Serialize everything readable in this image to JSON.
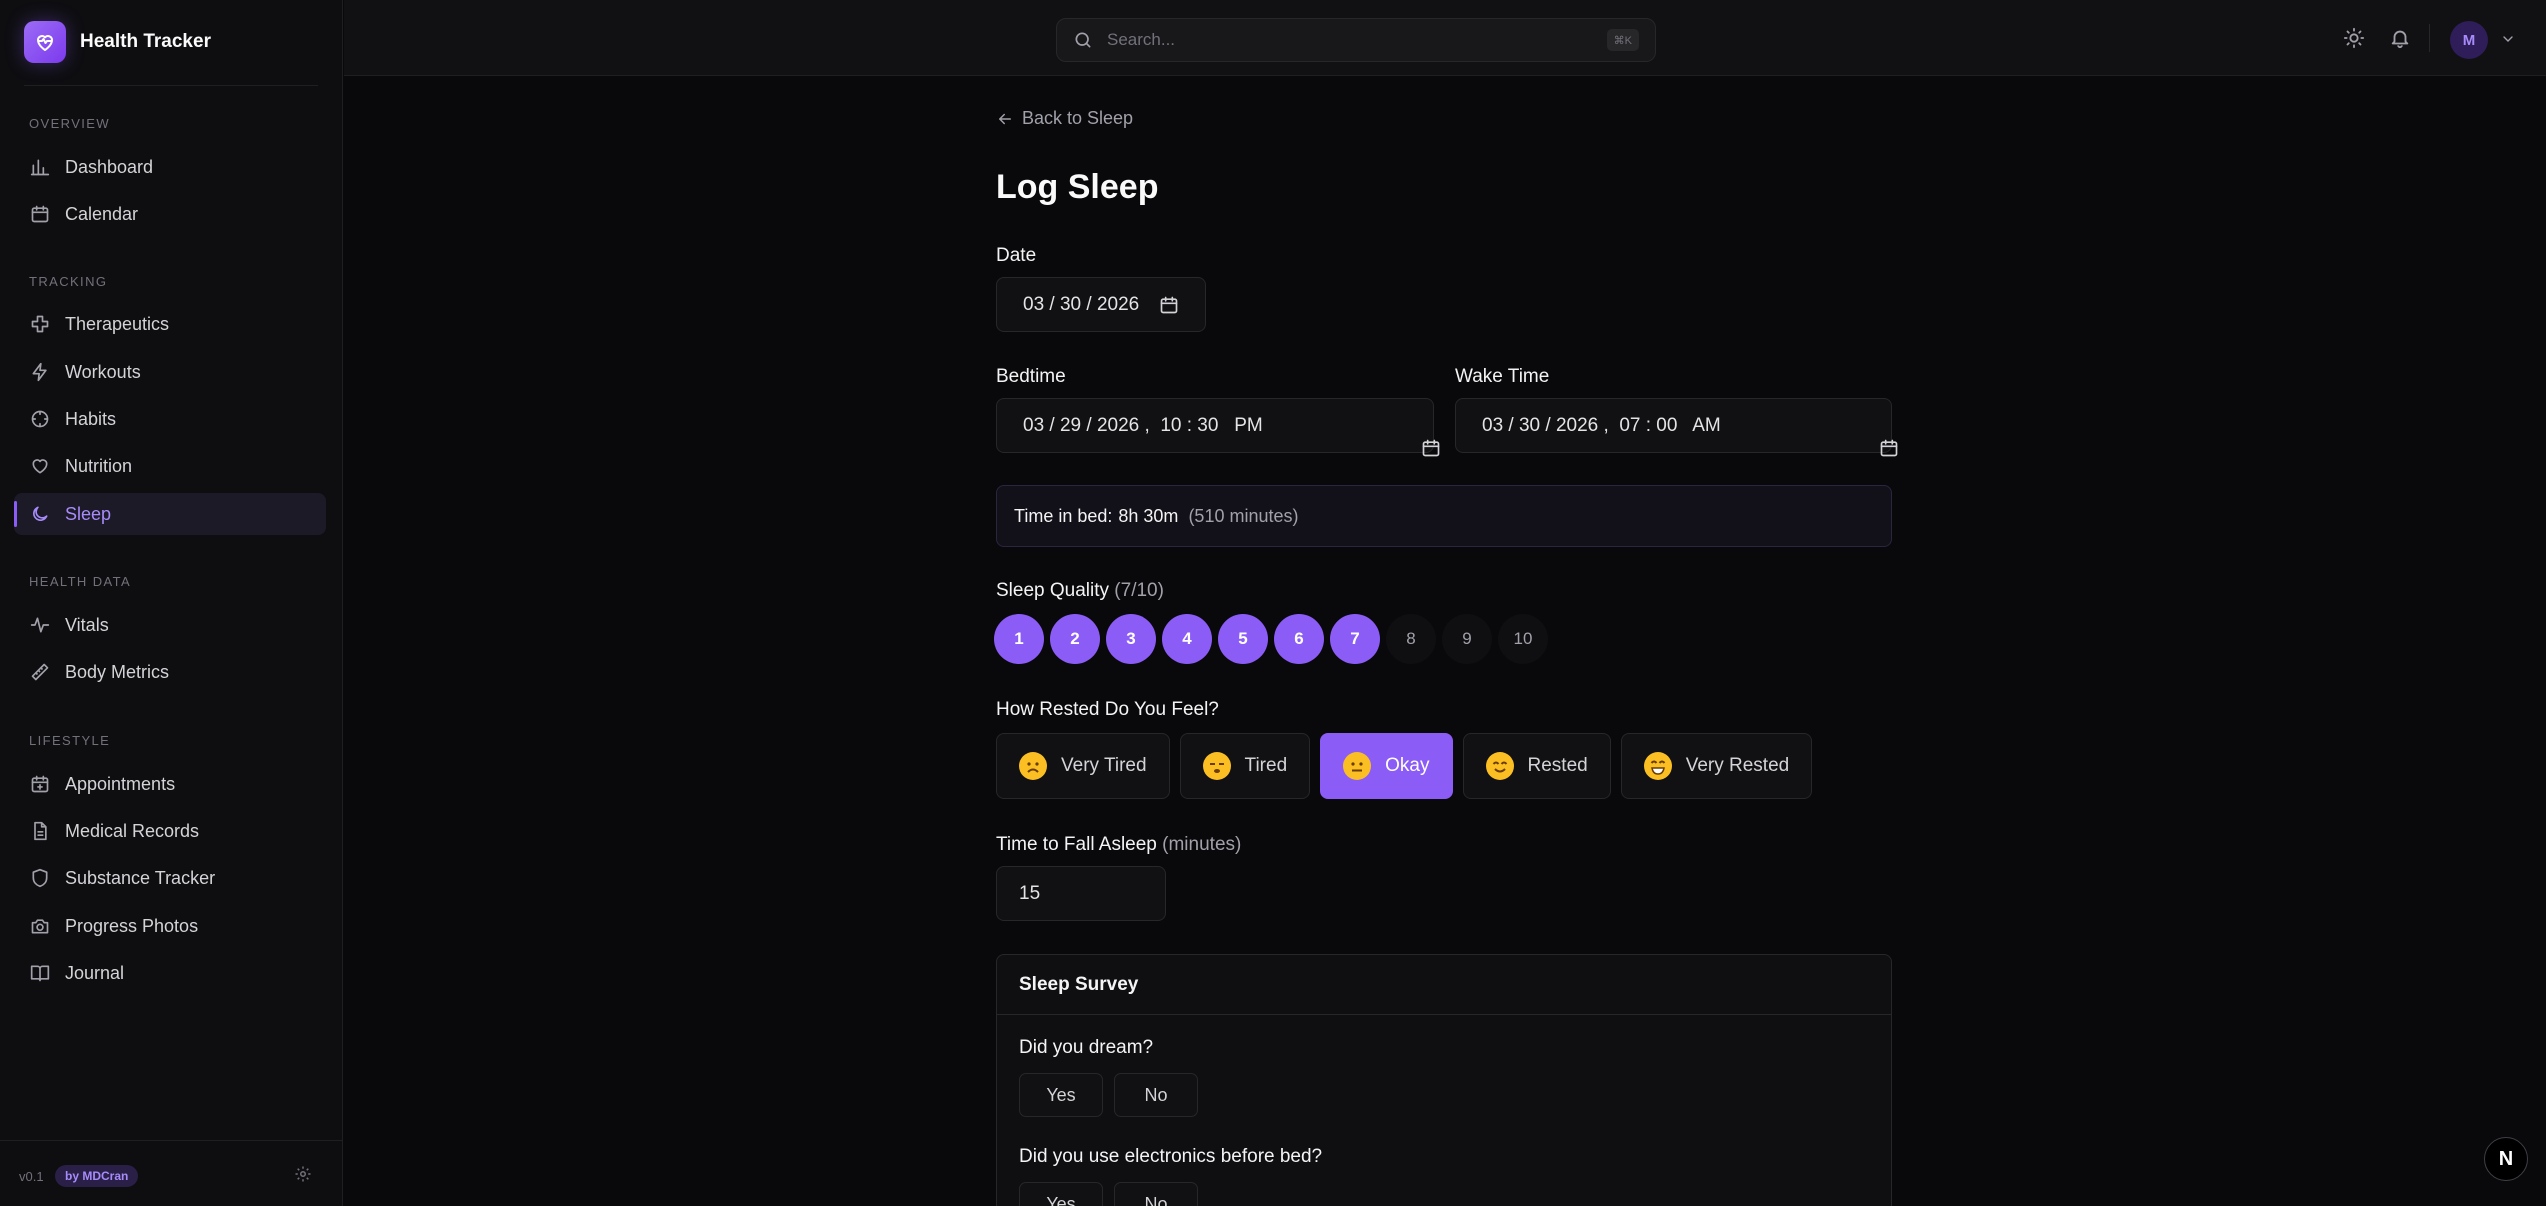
{
  "brand": {
    "name": "Health Tracker"
  },
  "sidebar": {
    "groups": [
      {
        "title": "OVERVIEW",
        "items": [
          {
            "label": "Dashboard",
            "icon": "bar-chart-icon"
          },
          {
            "label": "Calendar",
            "icon": "calendar-icon"
          }
        ]
      },
      {
        "title": "TRACKING",
        "items": [
          {
            "label": "Therapeutics",
            "icon": "cross-icon"
          },
          {
            "label": "Workouts",
            "icon": "lightning-icon"
          },
          {
            "label": "Habits",
            "icon": "target-icon"
          },
          {
            "label": "Nutrition",
            "icon": "heart-icon"
          },
          {
            "label": "Sleep",
            "icon": "moon-icon",
            "active": true
          }
        ]
      },
      {
        "title": "HEALTH DATA",
        "items": [
          {
            "label": "Vitals",
            "icon": "pulse-icon"
          },
          {
            "label": "Body Metrics",
            "icon": "ruler-icon"
          }
        ]
      },
      {
        "title": "LIFESTYLE",
        "items": [
          {
            "label": "Appointments",
            "icon": "calendar-plus-icon"
          },
          {
            "label": "Medical Records",
            "icon": "document-icon"
          },
          {
            "label": "Substance Tracker",
            "icon": "shield-icon"
          },
          {
            "label": "Progress Photos",
            "icon": "camera-icon"
          },
          {
            "label": "Journal",
            "icon": "book-icon"
          }
        ]
      }
    ],
    "footer": {
      "version": "v0.1",
      "badge": "by MDCran"
    }
  },
  "topbar": {
    "search_placeholder": "Search...",
    "search_shortcut": "⌘K",
    "avatar_initial": "M"
  },
  "page": {
    "back_link": "Back to Sleep",
    "title": "Log Sleep",
    "date": {
      "label": "Date",
      "value": "03 / 30 / 2026"
    },
    "bedtime": {
      "label": "Bedtime",
      "value": "03 / 29 / 2026 ,  10 : 30   PM"
    },
    "wake_time": {
      "label": "Wake Time",
      "value": "03 / 30 / 2026 ,  07 : 00   AM"
    },
    "time_in_bed": {
      "label": "Time in bed:",
      "value": "8h 30m",
      "detail": "(510 minutes)"
    },
    "sleep_quality": {
      "label": "Sleep Quality",
      "detail": "(7/10)",
      "selected": 7,
      "options": [
        "1",
        "2",
        "3",
        "4",
        "5",
        "6",
        "7",
        "8",
        "9",
        "10"
      ]
    },
    "rested": {
      "label": "How Rested Do You Feel?",
      "options": [
        {
          "label": "Very Tired",
          "icon": "tired-face-icon"
        },
        {
          "label": "Tired",
          "icon": "sleepy-face-icon"
        },
        {
          "label": "Okay",
          "icon": "neutral-face-icon",
          "selected": true
        },
        {
          "label": "Rested",
          "icon": "smile-face-icon"
        },
        {
          "label": "Very Rested",
          "icon": "grin-face-icon"
        }
      ]
    },
    "fall_asleep": {
      "label": "Time to Fall Asleep",
      "unit": "(minutes)",
      "value": "15"
    },
    "survey": {
      "title": "Sleep Survey",
      "q1": {
        "label": "Did you dream?",
        "yes": "Yes",
        "no": "No"
      },
      "q2": {
        "label": "Did you use electronics before bed?",
        "yes": "Yes",
        "no": "No"
      }
    }
  },
  "colors": {
    "accent": "#8b5cf6",
    "background": "#09090b"
  },
  "dev_badge": "N"
}
